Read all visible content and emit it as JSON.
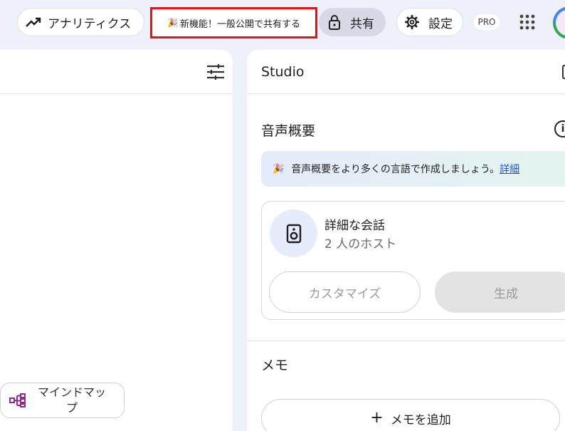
{
  "topbar": {
    "analytics_label": "アナリティクス",
    "new_feature_label": "新機能！一般公開で共有する",
    "share_label": "共有",
    "settings_label": "設定",
    "pro_badge": "PRO"
  },
  "left_panel": {
    "mindmap_label": "マインドマップ"
  },
  "studio": {
    "title": "Studio",
    "audio_overview": {
      "title": "音声概要",
      "banner_text": "音声概要をより多くの言語で作成しましょう。",
      "banner_link": "詳細",
      "card_title": "詳細な会話",
      "card_subtitle": "2 人のホスト",
      "customize_label": "カスタマイズ",
      "generate_label": "生成"
    },
    "memo": {
      "title": "メモ",
      "add_label": "メモを追加"
    }
  },
  "colors": {
    "background": "#eef0fa",
    "highlight_border": "#e0161b",
    "link": "#1a55d8"
  },
  "icons": [
    "trending-up-icon",
    "party-popper-icon",
    "lock-icon",
    "gear-icon",
    "apps-grid-icon",
    "avatar",
    "tune-icon",
    "mindmap-icon",
    "info-icon",
    "speaker-icon",
    "plus-icon"
  ]
}
